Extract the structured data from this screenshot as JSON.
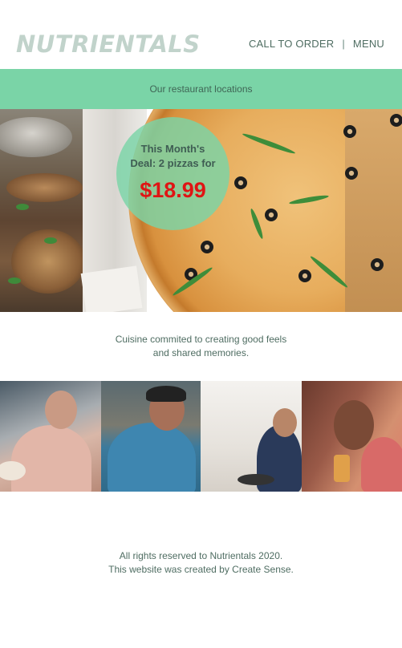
{
  "header": {
    "logo": "NUTRIENTALS",
    "nav": {
      "call_to_order": "CALL TO ORDER",
      "separator": "|",
      "menu": "MENU"
    }
  },
  "location_bar": {
    "label": "Our restaurant locations"
  },
  "deal": {
    "line1": "This Month's",
    "line2": "Deal: 2 pizzas for",
    "price": "$18.99"
  },
  "tagline": {
    "line1": "Cuisine commited to creating good feels",
    "line2": "and shared memories."
  },
  "footer": {
    "line1": "All rights reserved to Nutrientals 2020.",
    "line2": "This website was created by Create Sense."
  },
  "colors": {
    "accent_green": "#7ad4a7",
    "logo_gray": "#c1d3cb",
    "price_red": "#e01414",
    "text": "#4f6d62"
  }
}
